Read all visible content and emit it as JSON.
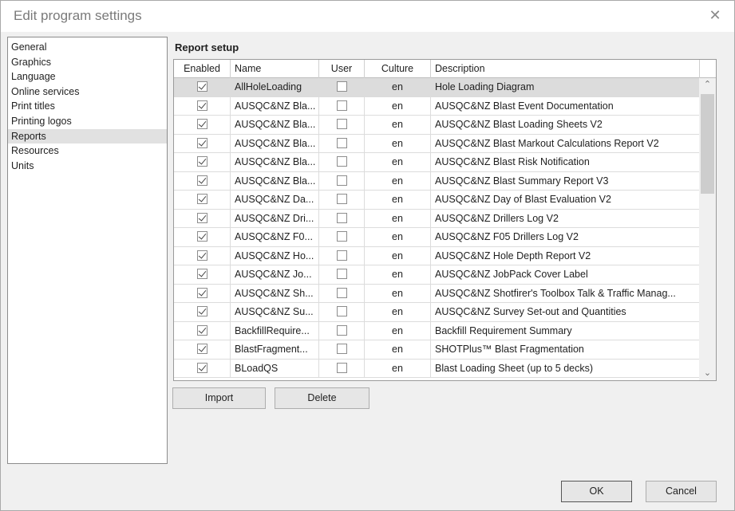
{
  "window": {
    "title": "Edit program settings"
  },
  "nav": {
    "items": [
      {
        "label": "General",
        "selected": false
      },
      {
        "label": "Graphics",
        "selected": false
      },
      {
        "label": "Language",
        "selected": false
      },
      {
        "label": "Online services",
        "selected": false
      },
      {
        "label": "Print titles",
        "selected": false
      },
      {
        "label": "Printing logos",
        "selected": false
      },
      {
        "label": "Reports",
        "selected": true
      },
      {
        "label": "Resources",
        "selected": false
      },
      {
        "label": "Units",
        "selected": false
      }
    ]
  },
  "report_setup": {
    "title": "Report setup",
    "columns": [
      "Enabled",
      "Name",
      "User",
      "Culture",
      "Description"
    ],
    "rows": [
      {
        "enabled": true,
        "name": "AllHoleLoading",
        "user": false,
        "culture": "en",
        "description": "Hole Loading Diagram",
        "selected": true
      },
      {
        "enabled": true,
        "name": "AUSQC&NZ Bla...",
        "user": false,
        "culture": "en",
        "description": "AUSQC&NZ Blast Event Documentation"
      },
      {
        "enabled": true,
        "name": "AUSQC&NZ Bla...",
        "user": false,
        "culture": "en",
        "description": "AUSQC&NZ Blast Loading Sheets V2"
      },
      {
        "enabled": true,
        "name": "AUSQC&NZ Bla...",
        "user": false,
        "culture": "en",
        "description": "AUSQC&NZ Blast Markout Calculations Report V2"
      },
      {
        "enabled": true,
        "name": "AUSQC&NZ Bla...",
        "user": false,
        "culture": "en",
        "description": "AUSQC&NZ Blast Risk Notification"
      },
      {
        "enabled": true,
        "name": "AUSQC&NZ Bla...",
        "user": false,
        "culture": "en",
        "description": "AUSQC&NZ Blast Summary Report V3"
      },
      {
        "enabled": true,
        "name": "AUSQC&NZ Da...",
        "user": false,
        "culture": "en",
        "description": "AUSQC&NZ Day of Blast Evaluation V2"
      },
      {
        "enabled": true,
        "name": "AUSQC&NZ Dri...",
        "user": false,
        "culture": "en",
        "description": "AUSQC&NZ Drillers Log V2"
      },
      {
        "enabled": true,
        "name": "AUSQC&NZ F0...",
        "user": false,
        "culture": "en",
        "description": "AUSQC&NZ F05 Drillers Log V2"
      },
      {
        "enabled": true,
        "name": "AUSQC&NZ Ho...",
        "user": false,
        "culture": "en",
        "description": "AUSQC&NZ Hole Depth Report V2"
      },
      {
        "enabled": true,
        "name": "AUSQC&NZ Jo...",
        "user": false,
        "culture": "en",
        "description": "AUSQC&NZ JobPack Cover Label"
      },
      {
        "enabled": true,
        "name": "AUSQC&NZ Sh...",
        "user": false,
        "culture": "en",
        "description": "AUSQC&NZ Shotfirer's Toolbox Talk & Traffic Manag..."
      },
      {
        "enabled": true,
        "name": "AUSQC&NZ Su...",
        "user": false,
        "culture": "en",
        "description": "AUSQC&NZ Survey Set-out and Quantities"
      },
      {
        "enabled": true,
        "name": "BackfillRequire...",
        "user": false,
        "culture": "en",
        "description": "Backfill Requirement Summary"
      },
      {
        "enabled": true,
        "name": "BlastFragment...",
        "user": false,
        "culture": "en",
        "description": "SHOTPlus™ Blast Fragmentation"
      },
      {
        "enabled": true,
        "name": "BLoadQS",
        "user": false,
        "culture": "en",
        "description": "Blast Loading Sheet (up to 5 decks)"
      }
    ],
    "scroll": {
      "up_glyph": "⌃",
      "down_glyph": "⌄"
    }
  },
  "buttons": {
    "import": "Import",
    "delete": "Delete",
    "ok": "OK",
    "cancel": "Cancel"
  },
  "icons": {
    "close": "✕"
  }
}
